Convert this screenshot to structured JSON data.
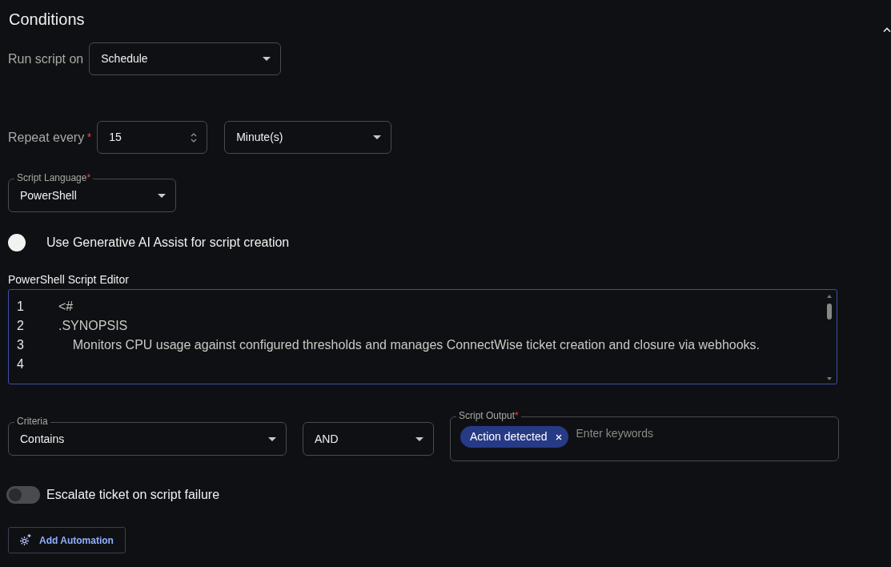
{
  "section": {
    "title": "Conditions",
    "expanded": true
  },
  "run_script_on": {
    "label": "Run script on",
    "value": "Schedule"
  },
  "repeat": {
    "label": "Repeat every",
    "required_mark": "*",
    "value": "15",
    "unit": "Minute(s)"
  },
  "script_language": {
    "label": "Script Language",
    "required_mark": "*",
    "value": "PowerShell"
  },
  "toggles": [
    {
      "kind": "knob",
      "label": "Use Generative AI Assist for script creation",
      "on": false
    }
  ],
  "editor": {
    "label": "PowerShell Script Editor",
    "lines": [
      {
        "number": "1",
        "text": "<#"
      },
      {
        "number": "2",
        "text": ".SYNOPSIS"
      },
      {
        "number": "3",
        "text": "    Monitors CPU usage against configured thresholds and manages ConnectWise ticket creation and closure via webhooks."
      },
      {
        "number": "4"
      }
    ]
  },
  "criteria": {
    "label": "Criteria",
    "value": "Contains"
  },
  "operator": {
    "value": "AND"
  },
  "script_output": {
    "label": "Script Output",
    "required_mark": "*",
    "tags": [
      "Action detected"
    ],
    "placeholder": "Enter keywords"
  },
  "escalate": {
    "kind": "switch",
    "label": "Escalate ticket on script failure",
    "on": false
  },
  "add_button": {
    "label": "Add Automation"
  }
}
